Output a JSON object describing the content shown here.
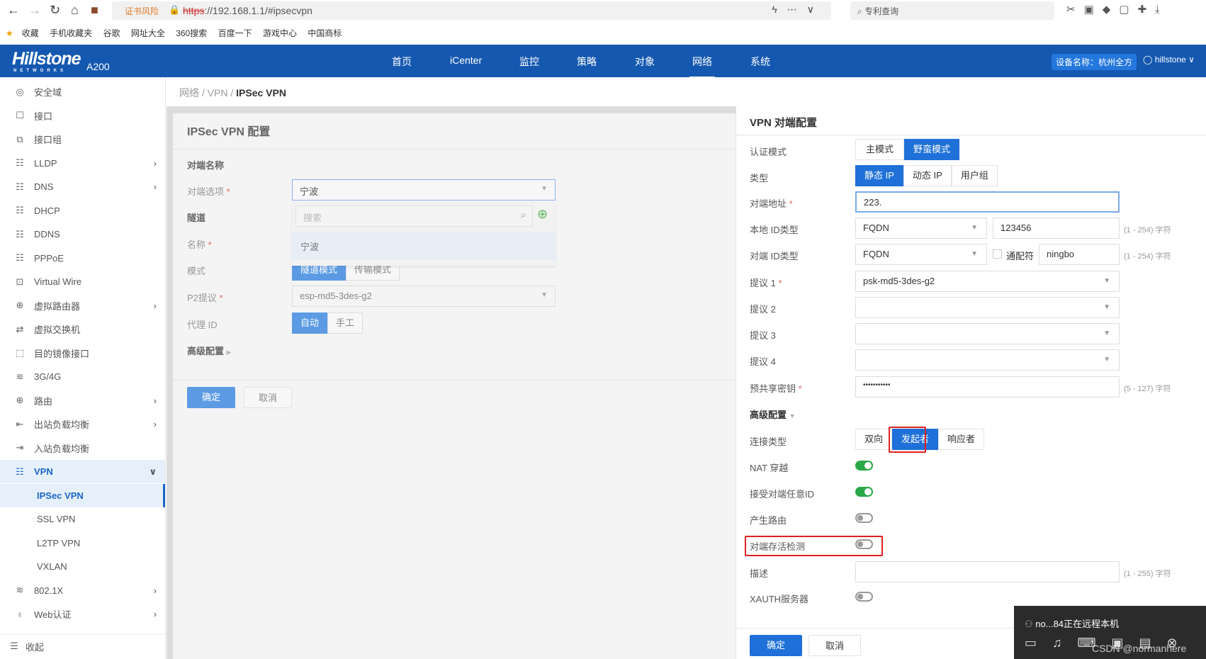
{
  "browser": {
    "cert_warning": "证书风险",
    "url_scheme": "https",
    "url_rest": "://192.168.1.1/#ipsecvpn",
    "search_placeholder": "专利查询",
    "bookmarks": [
      "收藏",
      "手机收藏夹",
      "谷歌",
      "网址大全",
      "360搜索",
      "百度一下",
      "游戏中心",
      "中国商标"
    ]
  },
  "header": {
    "logo": "Hillstone",
    "logo_sub": "NETWORKS",
    "model": "A200",
    "nav": [
      "首页",
      "iCenter",
      "监控",
      "策略",
      "对象",
      "网络",
      "系统"
    ],
    "active_nav": "网络",
    "device_name": "设备名称：杭州全方",
    "user": "hillstone"
  },
  "sidebar": {
    "items": [
      {
        "label": "安全域",
        "icon": "◎"
      },
      {
        "label": "接口",
        "icon": "☐"
      },
      {
        "label": "接口组",
        "icon": "⧉"
      },
      {
        "label": "LLDP",
        "icon": "☷",
        "chevron": true
      },
      {
        "label": "DNS",
        "icon": "☷",
        "chevron": true
      },
      {
        "label": "DHCP",
        "icon": "☷"
      },
      {
        "label": "DDNS",
        "icon": "☷"
      },
      {
        "label": "PPPoE",
        "icon": "☷"
      },
      {
        "label": "Virtual Wire",
        "icon": "⊡"
      },
      {
        "label": "虚拟路由器",
        "icon": "⊕",
        "chevron": true
      },
      {
        "label": "虚拟交换机",
        "icon": "⇄"
      },
      {
        "label": "目的镜像接口",
        "icon": "⬚"
      },
      {
        "label": "3G/4G",
        "icon": "≋"
      },
      {
        "label": "路由",
        "icon": "⊕",
        "chevron": true
      },
      {
        "label": "出站负载均衡",
        "icon": "⇤",
        "chevron": true
      },
      {
        "label": "入站负载均衡",
        "icon": "⇥"
      },
      {
        "label": "VPN",
        "icon": "☷",
        "chevron": true
      },
      {
        "label": "IPSec VPN"
      },
      {
        "label": "SSL VPN"
      },
      {
        "label": "L2TP VPN"
      },
      {
        "label": "VXLAN"
      },
      {
        "label": "802.1X",
        "icon": "≋",
        "chevron": true
      },
      {
        "label": "Web认证",
        "icon": "♁",
        "chevron": true
      }
    ],
    "collapse": "收起"
  },
  "breadcrumb": [
    "网络",
    "VPN",
    "IPSec VPN"
  ],
  "ipsec_form": {
    "title": "IPSec VPN 配置",
    "peer_section": "对端名称",
    "peer_option_label": "对端选项",
    "peer_option_value": "宁波",
    "search_placeholder": "搜索",
    "dropdown_options": [
      "宁波"
    ],
    "tunnel_section": "隧道",
    "name_label": "名称",
    "mode_label": "模式",
    "modes": [
      "隧道模式",
      "传输模式"
    ],
    "p2_label": "P2提议",
    "p2_value": "esp-md5-3des-g2",
    "proxy_label": "代理 ID",
    "proxy_options": [
      "自动",
      "手工"
    ],
    "advanced": "高级配置",
    "ok": "确定",
    "cancel": "取消"
  },
  "peer_panel": {
    "title": "VPN 对端配置",
    "auth_mode_label": "认证模式",
    "auth_modes": [
      "主模式",
      "野蛮模式"
    ],
    "type_label": "类型",
    "types": [
      "静态 IP",
      "动态 IP",
      "用户组"
    ],
    "peer_addr_label": "对端地址",
    "peer_addr_value": "223.",
    "local_id_label": "本地 ID类型",
    "local_id_type": "FQDN",
    "local_id_value": "123456",
    "local_id_hint": "(1 - 254) 字符",
    "peer_id_label": "对端 ID类型",
    "peer_id_type": "FQDN",
    "wildcard_label": "通配符",
    "peer_id_value": "ningbo",
    "peer_id_hint": "(1 - 254) 字符",
    "proposal1_label": "提议 1",
    "proposal1_value": "psk-md5-3des-g2",
    "proposal2_label": "提议 2",
    "proposal3_label": "提议 3",
    "proposal4_label": "提议 4",
    "psk_label": "预共享密钥",
    "psk_value": "•••••••••••",
    "psk_hint": "(5 - 127) 字符",
    "advanced": "高级配置",
    "conn_type_label": "连接类型",
    "conn_types": [
      "双向",
      "发起者",
      "响应者"
    ],
    "nat_label": "NAT 穿越",
    "nat_on": true,
    "accept_any_label": "接受对端任意ID",
    "accept_any_on": true,
    "gen_route_label": "产生路由",
    "gen_route_on": false,
    "dpd_label": "对端存活检测",
    "dpd_on": false,
    "desc_label": "描述",
    "desc_hint": "(1 - 255) 字符",
    "xauth_label": "XAUTH服务器",
    "xauth_on": false,
    "ok": "确定",
    "cancel": "取消"
  },
  "remote": {
    "text": "no...84正在远程本机",
    "watermark": "CSDN @normanhere"
  }
}
